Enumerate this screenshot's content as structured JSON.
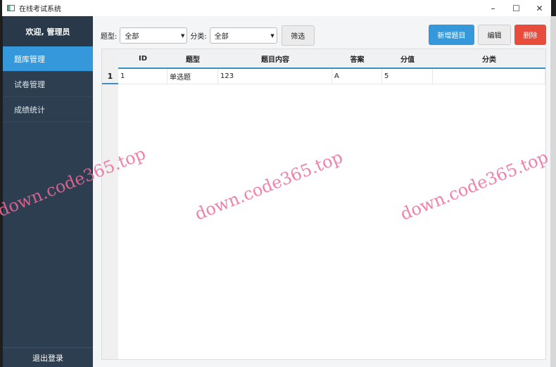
{
  "window": {
    "title": "在线考试系统",
    "controls": [
      "–",
      "☐",
      "✕"
    ]
  },
  "sidebar": {
    "welcome": "欢迎, 管理员",
    "items": [
      {
        "label": "题库管理",
        "active": true
      },
      {
        "label": "试卷管理"
      },
      {
        "label": "成绩统计"
      }
    ],
    "logout": "退出登录"
  },
  "toolbar": {
    "type_label": "题型:",
    "type_value": "全部",
    "category_label": "分类:",
    "category_value": "全部",
    "filter": "筛选",
    "add": "新增题目",
    "edit": "编辑",
    "delete": "删除"
  },
  "table": {
    "headers": [
      "ID",
      "题型",
      "题目内容",
      "答案",
      "分值",
      "分类"
    ],
    "rows": [
      {
        "num": "1",
        "cells": [
          "1",
          "单选题",
          "123",
          "A",
          "5",
          ""
        ]
      }
    ]
  },
  "watermark": "down.code365.top",
  "colors": {
    "sidebar": "#2c3e50",
    "accent": "#3498db",
    "danger": "#e74c3c"
  }
}
